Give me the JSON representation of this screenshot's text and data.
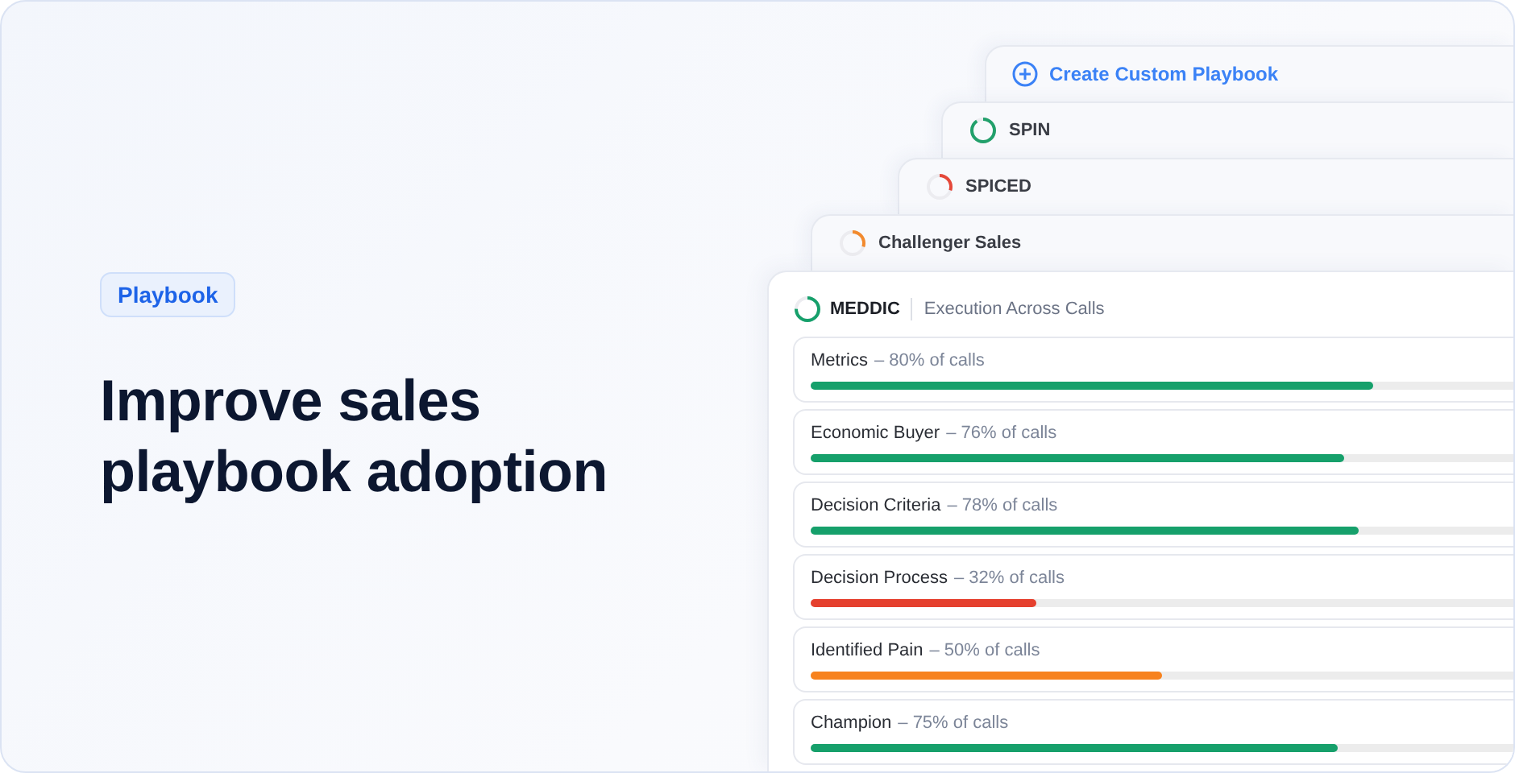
{
  "tag": "Playbook",
  "headline": "Improve sales playbook adoption",
  "playbooks": [
    {
      "kind": "create",
      "label": "Create Custom Playbook"
    },
    {
      "kind": "playbook",
      "label": "SPIN",
      "level": 0.9,
      "color": "#22a06b"
    },
    {
      "kind": "playbook",
      "label": "SPICED",
      "level": 0.3,
      "color": "#e5483a"
    },
    {
      "kind": "playbook",
      "label": "Challenger Sales",
      "level": 0.3,
      "color": "#f28a2e"
    }
  ],
  "main_card": {
    "title": "MEDDIC",
    "subtitle": "Execution Across Calls",
    "level": 0.75,
    "color": "#16a06b",
    "rows": [
      {
        "name": "Metrics",
        "reading": "– 80% of calls",
        "level": 0.8,
        "color": "#16a06b"
      },
      {
        "name": "Economic Buyer",
        "reading": "– 76% of calls",
        "level": 0.76,
        "color": "#16a06b"
      },
      {
        "name": "Decision Criteria",
        "reading": "– 78% of calls",
        "level": 0.78,
        "color": "#16a06b"
      },
      {
        "name": "Decision Process",
        "reading": "– 32% of calls",
        "level": 0.32,
        "color": "#e5402e"
      },
      {
        "name": "Identified Pain",
        "reading": "– 50% of calls",
        "level": 0.5,
        "color": "#f7821e"
      },
      {
        "name": "Champion",
        "reading": "– 75% of calls",
        "level": 0.75,
        "color": "#16a06b"
      }
    ]
  }
}
